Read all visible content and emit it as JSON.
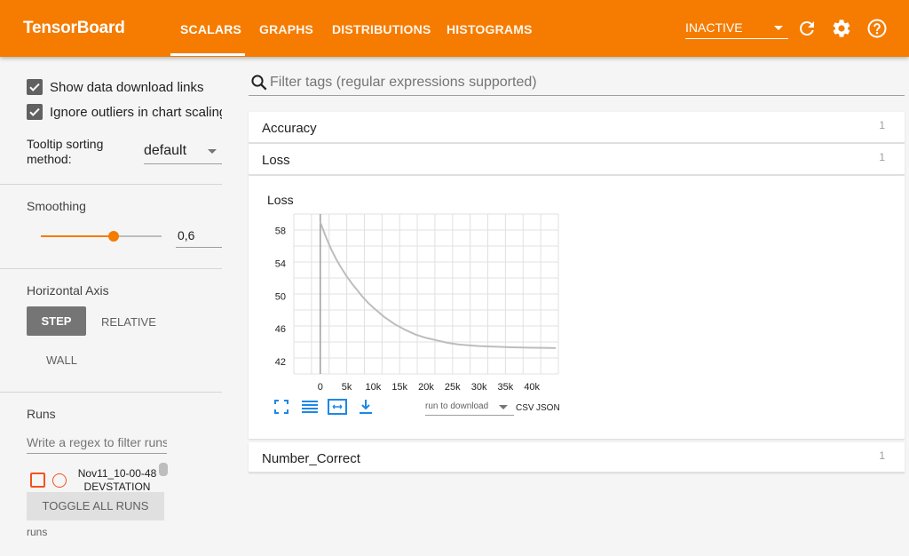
{
  "header": {
    "brand": "TensorBoard",
    "tabs": [
      {
        "label": "SCALARS",
        "active": true
      },
      {
        "label": "GRAPHS",
        "active": false
      },
      {
        "label": "DISTRIBUTIONS",
        "active": false
      },
      {
        "label": "HISTOGRAMS",
        "active": false
      }
    ],
    "status_select": "INACTIVE",
    "icons": [
      "refresh-icon",
      "settings-gear-icon",
      "help-icon"
    ],
    "color": "#f57c00"
  },
  "sidebar": {
    "show_download_links": {
      "label": "Show data download links",
      "checked": true
    },
    "ignore_outliers": {
      "label": "Ignore outliers in chart scaling",
      "checked": true
    },
    "tooltip_sorting": {
      "label": "Tooltip sorting method:",
      "value": "default"
    },
    "smoothing": {
      "title": "Smoothing",
      "value": "0,6",
      "fraction": 0.6
    },
    "horizontal_axis": {
      "title": "Horizontal Axis",
      "options": [
        "STEP",
        "RELATIVE",
        "WALL"
      ],
      "selected": "STEP"
    },
    "runs": {
      "title": "Runs",
      "filter_placeholder": "Write a regex to filter runs",
      "items": [
        {
          "name": "Nov11_10-00-48 DEVSTATION",
          "line1": "Nov11_10-00-48",
          "line2": "DEVSTATION",
          "color": "#f4511e"
        }
      ],
      "toggle_label": "TOGGLE ALL RUNS",
      "footer": "runs"
    }
  },
  "main": {
    "filter_placeholder": "Filter tags (regular expressions supported)",
    "categories": [
      {
        "name": "Accuracy",
        "count": "1"
      },
      {
        "name": "Loss",
        "count": "1"
      },
      {
        "name": "Number_Correct",
        "count": "1"
      }
    ],
    "card": {
      "title": "Loss",
      "download_select": "run to download",
      "csv_label": "CSV",
      "json_label": "JSON"
    }
  },
  "chart_data": {
    "type": "line",
    "title": "Loss",
    "xlabel": "",
    "ylabel": "",
    "x_tick_labels": [
      "0",
      "5k",
      "10k",
      "15k",
      "20k",
      "25k",
      "30k",
      "35k",
      "40k"
    ],
    "y_tick_labels": [
      "42",
      "46",
      "50",
      "54",
      "58"
    ],
    "xlim": [
      -5000,
      45000
    ],
    "ylim": [
      40.5,
      60
    ],
    "grid": true,
    "series": [
      {
        "color": "#bdbdbd",
        "x": [
          0,
          1000,
          2000,
          3000,
          4000,
          5000,
          6000,
          7000,
          8000,
          9000,
          10000,
          12000,
          14000,
          16000,
          18000,
          20000,
          22000,
          24000,
          26000,
          28000,
          30000,
          32000,
          34000,
          36000,
          38000,
          40000,
          42000,
          44500
        ],
        "values": [
          59.0,
          57.3,
          55.8,
          54.5,
          53.4,
          52.4,
          51.5,
          50.7,
          49.9,
          49.2,
          48.6,
          47.5,
          46.6,
          45.9,
          45.3,
          44.9,
          44.6,
          44.3,
          44.1,
          44.0,
          43.9,
          43.85,
          43.8,
          43.75,
          43.72,
          43.7,
          43.68,
          43.65
        ]
      }
    ]
  }
}
